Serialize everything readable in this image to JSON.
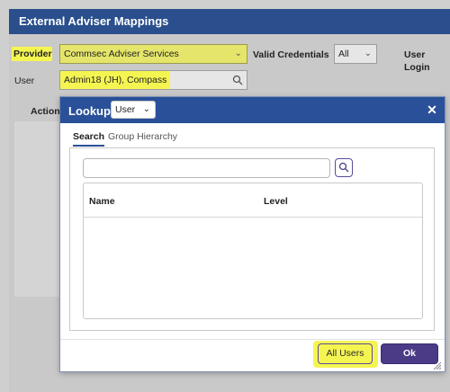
{
  "page": {
    "title": "External Adviser Mappings",
    "provider_label": "Provider",
    "provider_value": "Commsec Adviser Services",
    "valid_credentials_label": "Valid Credentials",
    "valid_credentials_value": "All",
    "user_login_label": "User Login",
    "user_label": "User",
    "user_value": "Admin18 (JH), Compass",
    "action_label": "Action"
  },
  "modal": {
    "title": "Lookup",
    "type_value": "User",
    "tabs": [
      {
        "label": "Search",
        "active": true
      },
      {
        "label": "Group Hierarchy",
        "active": false
      }
    ],
    "search_value": "",
    "columns": [
      "Name",
      "Level"
    ],
    "rows": [],
    "all_users_label": "All Users",
    "ok_label": "Ok"
  },
  "icons": {
    "close": "close-icon",
    "search": "search-icon",
    "chevron": "chevron-down-icon",
    "resize": "resize-grip-icon"
  },
  "colors": {
    "header_blue": "#2a4f8c",
    "modal_header_blue": "#2a5099",
    "highlight_yellow": "#f5f552",
    "primary_purple": "#4b3b86"
  }
}
